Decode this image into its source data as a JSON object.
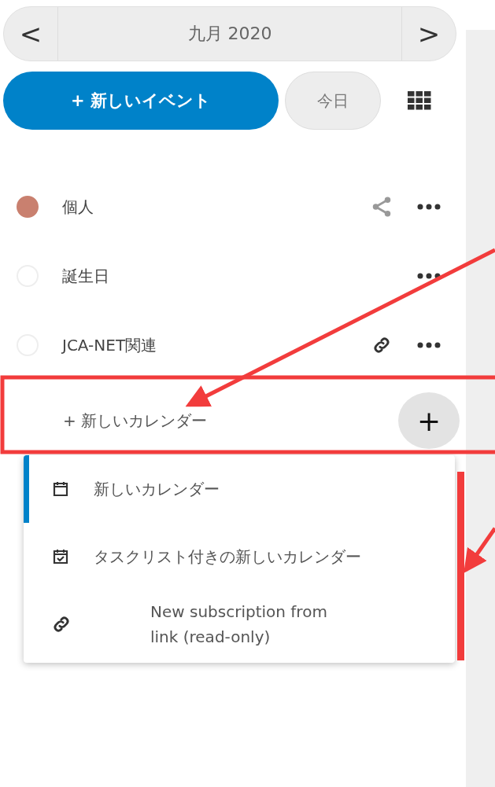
{
  "month_nav": {
    "prev": "<",
    "label": "九月 2020",
    "next": ">"
  },
  "new_event_button": "+ 新しいイベント",
  "today_button": "今日",
  "calendars": [
    {
      "name": "個人",
      "enabled": true,
      "color": "#c9806f",
      "kind": "shared"
    },
    {
      "name": "誕生日",
      "enabled": false,
      "kind": "plain"
    },
    {
      "name": "JCA-NET関連",
      "enabled": false,
      "kind": "linked"
    }
  ],
  "new_calendar": {
    "label": "+ 新しいカレンダー",
    "add_button": "+"
  },
  "menu": [
    {
      "label": "新しいカレンダー",
      "kind": "calendar",
      "selected": true
    },
    {
      "label": "タスクリスト付きの新しいカレンダー",
      "kind": "tasks",
      "selected": false
    },
    {
      "label": "New subscription from link (read-only)",
      "kind": "subscription",
      "selected": false
    }
  ]
}
